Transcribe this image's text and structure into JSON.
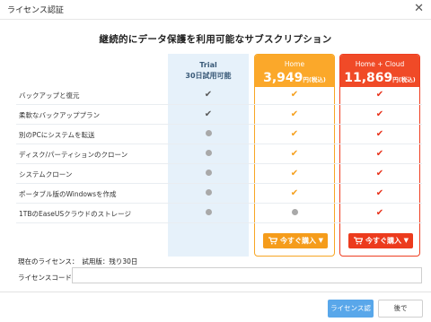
{
  "window": {
    "title": "ライセンス認証",
    "close_icon": "close-icon"
  },
  "heading": "継続的にデータ保護を利用可能なサブスクリプション",
  "plans": {
    "trial": {
      "name": "Trial",
      "sub": "30日試用可能"
    },
    "home": {
      "name": "Home",
      "price": "3,949",
      "unit": "円(税込)",
      "buy_label": "今すぐ購入",
      "color": "#fba82a"
    },
    "cloud": {
      "name": "Home + Cloud",
      "price": "11,869",
      "unit": "円(税込)",
      "buy_label": "今すぐ購入",
      "color": "#f04a27"
    }
  },
  "features": [
    {
      "label": "バックアップと復元",
      "trial": "check",
      "home": "check",
      "cloud": "check"
    },
    {
      "label": "柔軟なバックアッププラン",
      "trial": "check",
      "home": "check",
      "cloud": "check"
    },
    {
      "label": "別のPCにシステムを転送",
      "trial": "dot",
      "home": "check",
      "cloud": "check"
    },
    {
      "label": "ディスク/パーティションのクローン",
      "trial": "dot",
      "home": "check",
      "cloud": "check"
    },
    {
      "label": "システムクローン",
      "trial": "dot",
      "home": "check",
      "cloud": "check"
    },
    {
      "label": "ポータブル版のWindowsを作成",
      "trial": "dot",
      "home": "check",
      "cloud": "check"
    },
    {
      "label": "1TBのEaseUSクラウドのストレージ",
      "trial": "dot",
      "home": "dot",
      "cloud": "check"
    }
  ],
  "license": {
    "status_label": "現在のライセンス：",
    "status_value": "試用版：残り30日",
    "code_label": "ライセンスコード：",
    "code_value": "",
    "code_placeholder": ""
  },
  "buttons": {
    "activate": "ライセンス認証",
    "later": "後で"
  }
}
